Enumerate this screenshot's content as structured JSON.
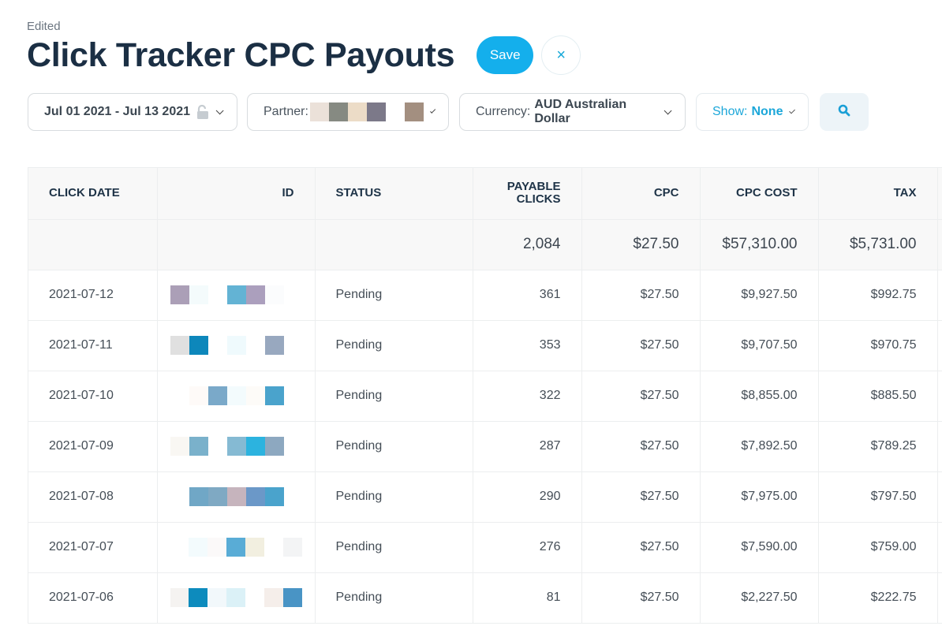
{
  "header": {
    "status": "Edited",
    "title": "Click Tracker CPC Payouts",
    "save_label": "Save",
    "close_label": "×"
  },
  "filters": {
    "date_range": "Jul 01 2021 - Jul 13 2021",
    "date_lock_icon": "unlocked-padlock-icon",
    "partner_label": "Partner:",
    "partner_value": "[redacted]",
    "currency_label": "Currency:",
    "currency_value": "AUD Australian Dollar",
    "show_label": "Show:",
    "show_value": "None",
    "search_icon": "search-icon"
  },
  "table": {
    "columns": [
      "Click Date",
      "ID",
      "Status",
      "Payable Clicks",
      "CPC",
      "CPC Cost",
      "Tax"
    ],
    "totals": {
      "payable_clicks": "2,084",
      "cpc": "$27.50",
      "cpc_cost": "$57,310.00",
      "tax": "$5,731.00"
    },
    "rows": [
      {
        "date": "2021-07-12",
        "id": "[redacted]",
        "status": "Pending",
        "clicks": "361",
        "cpc": "$27.50",
        "cost": "$9,927.50",
        "tax": "$992.75"
      },
      {
        "date": "2021-07-11",
        "id": "[redacted]",
        "status": "Pending",
        "clicks": "353",
        "cpc": "$27.50",
        "cost": "$9,707.50",
        "tax": "$970.75"
      },
      {
        "date": "2021-07-10",
        "id": "[redacted]",
        "status": "Pending",
        "clicks": "322",
        "cpc": "$27.50",
        "cost": "$8,855.00",
        "tax": "$885.50"
      },
      {
        "date": "2021-07-09",
        "id": "[redacted]",
        "status": "Pending",
        "clicks": "287",
        "cpc": "$27.50",
        "cost": "$7,892.50",
        "tax": "$789.25"
      },
      {
        "date": "2021-07-08",
        "id": "[redacted]",
        "status": "Pending",
        "clicks": "290",
        "cpc": "$27.50",
        "cost": "$7,975.00",
        "tax": "$797.50"
      },
      {
        "date": "2021-07-07",
        "id": "[redacted]",
        "status": "Pending",
        "clicks": "276",
        "cpc": "$27.50",
        "cost": "$7,590.00",
        "tax": "$759.00"
      },
      {
        "date": "2021-07-06",
        "id": "[redacted]",
        "status": "Pending",
        "clicks": "81",
        "cpc": "$27.50",
        "cost": "$2,227.50",
        "tax": "$222.75"
      }
    ]
  },
  "colors": {
    "accent": "#14afec",
    "title": "#1b2f44",
    "show_accent": "#1ca7d9"
  }
}
